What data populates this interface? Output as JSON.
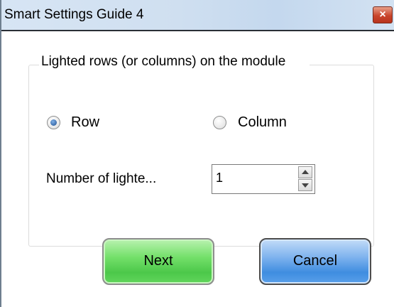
{
  "window": {
    "title": "Smart Settings Guide 4",
    "close_glyph": "×",
    "close_icon": "close-icon"
  },
  "group": {
    "caption": "Lighted rows (or columns) on the module"
  },
  "orientation": {
    "options": [
      {
        "label": "Row",
        "selected": true
      },
      {
        "label": "Column",
        "selected": false
      }
    ]
  },
  "lighted_count": {
    "label": "Number of lighte...",
    "value": "1",
    "up_icon": "spin-up-icon",
    "down_icon": "spin-down-icon"
  },
  "buttons": {
    "next_label": "Next",
    "cancel_label": "Cancel"
  },
  "colors": {
    "next_button": "#4cc84a",
    "cancel_button": "#3f8de0",
    "close_button": "#c9452b",
    "titlebar": "#cfdff0"
  }
}
